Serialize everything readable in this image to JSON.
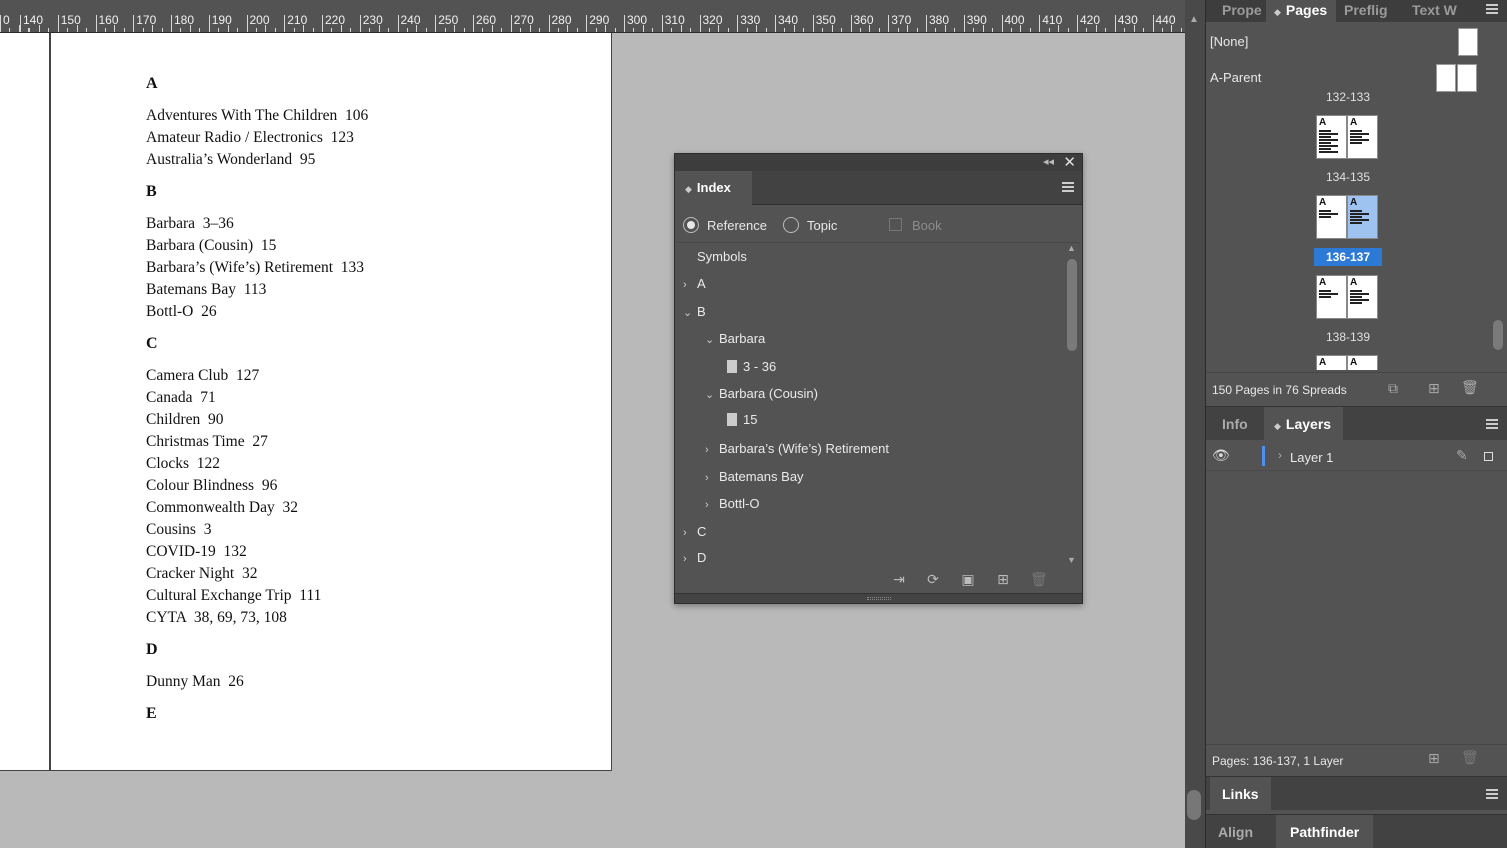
{
  "ruler": {
    "labels": [
      "0",
      "140",
      "150",
      "160",
      "170",
      "180",
      "190",
      "200",
      "210",
      "220",
      "230",
      "240",
      "250",
      "260",
      "270",
      "280",
      "290",
      "300",
      "310",
      "320",
      "330",
      "340",
      "350",
      "360",
      "370",
      "380",
      "390",
      "400",
      "410",
      "420",
      "430",
      "440"
    ]
  },
  "document": {
    "entries": [
      {
        "kind": "head",
        "text": "A"
      },
      {
        "kind": "entry",
        "text": "Adventures With The Children  106"
      },
      {
        "kind": "entry",
        "text": "Amateur Radio / Electronics  123"
      },
      {
        "kind": "entry",
        "text": "Australia’s Wonderland  95"
      },
      {
        "kind": "head",
        "text": "B"
      },
      {
        "kind": "entry",
        "text": "Barbara  3–36"
      },
      {
        "kind": "entry",
        "text": "Barbara (Cousin)  15"
      },
      {
        "kind": "entry",
        "text": "Barbara’s (Wife’s) Retirement  133"
      },
      {
        "kind": "entry",
        "text": "Batemans Bay  113"
      },
      {
        "kind": "entry",
        "text": "Bottl-O  26"
      },
      {
        "kind": "head",
        "text": "C"
      },
      {
        "kind": "entry",
        "text": "Camera Club  127"
      },
      {
        "kind": "entry",
        "text": "Canada  71"
      },
      {
        "kind": "entry",
        "text": "Children  90"
      },
      {
        "kind": "entry",
        "text": "Christmas Time  27"
      },
      {
        "kind": "entry",
        "text": "Clocks  122"
      },
      {
        "kind": "entry",
        "text": "Colour Blindness  96"
      },
      {
        "kind": "entry",
        "text": "Commonwealth Day  32"
      },
      {
        "kind": "entry",
        "text": "Cousins  3"
      },
      {
        "kind": "entry",
        "text": "COVID-19  132"
      },
      {
        "kind": "entry",
        "text": "Cracker Night  32"
      },
      {
        "kind": "entry",
        "text": "Cultural Exchange Trip  111"
      },
      {
        "kind": "entry",
        "text": "CYTA  38, 69, 73, 108"
      },
      {
        "kind": "head",
        "text": "D"
      },
      {
        "kind": "entry",
        "text": "Dunny Man  26"
      },
      {
        "kind": "head",
        "text": "E"
      }
    ]
  },
  "index_panel": {
    "tab_label": "Index",
    "options": {
      "reference_label": "Reference",
      "topic_label": "Topic",
      "book_label": "Book",
      "selected": "Reference"
    },
    "tree": [
      {
        "label": "Symbols",
        "level": 0,
        "chevron": "none"
      },
      {
        "label": "A",
        "level": 0,
        "chevron": "right"
      },
      {
        "label": "B",
        "level": 0,
        "chevron": "down"
      },
      {
        "label": "Barbara",
        "level": 1,
        "chevron": "down"
      },
      {
        "label": "3 - 36",
        "level": 2,
        "chevron": "page"
      },
      {
        "label": "Barbara (Cousin)",
        "level": 1,
        "chevron": "down"
      },
      {
        "label": "15",
        "level": 2,
        "chevron": "page"
      },
      {
        "label": "Barbara’s (Wife’s) Retirement",
        "level": 1,
        "chevron": "right"
      },
      {
        "label": "Batemans Bay",
        "level": 1,
        "chevron": "right"
      },
      {
        "label": "Bottl-O",
        "level": 1,
        "chevron": "right"
      },
      {
        "label": "C",
        "level": 0,
        "chevron": "right"
      },
      {
        "label": "D",
        "level": 0,
        "chevron": "right"
      }
    ]
  },
  "dock": {
    "top_tabs": [
      "Prope",
      "Pages",
      "Preflig",
      "Text W"
    ],
    "active_top_tab": "Pages",
    "parents": [
      {
        "label": "[None]"
      },
      {
        "label": "A-Parent"
      }
    ],
    "spreads": [
      {
        "label": "132-133"
      },
      {
        "label": "134-135"
      },
      {
        "label": "136-137",
        "selected": true
      },
      {
        "label": "138-139"
      }
    ],
    "pages_status": "150 Pages in 76 Spreads",
    "layers_tabs": [
      "Info",
      "Layers"
    ],
    "active_layers_tab": "Layers",
    "layer": {
      "name": "Layer 1"
    },
    "layers_status": "Pages: 136-137, 1 Layer",
    "links_tab": "Links",
    "bottom_tabs": [
      "Align",
      "Pathfinder"
    ],
    "active_bottom_tab": "Pathfinder"
  },
  "colors": {
    "panel_bg": "#535353",
    "selection_blue": "#2d7ad6",
    "layer_color": "#4d8ef0"
  }
}
